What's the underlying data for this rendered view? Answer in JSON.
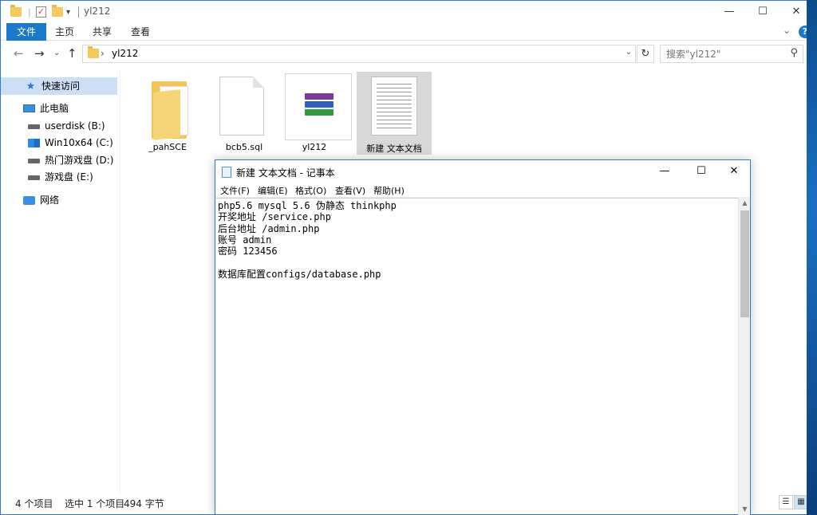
{
  "explorer": {
    "title": "yl212",
    "window_controls": {
      "minimize": "—",
      "maximize": "☐",
      "close": "✕"
    },
    "ribbon_tabs": [
      "文件",
      "主页",
      "共享",
      "查看"
    ],
    "ribbon_help": "?",
    "address_path": "yl212",
    "search_placeholder": "搜索\"yl212\"",
    "sidebar": [
      {
        "label": "快速访问",
        "icon": "star-icon"
      },
      {
        "label": "此电脑",
        "icon": "computer-icon"
      },
      {
        "label": "userdisk (B:)",
        "icon": "drive-icon"
      },
      {
        "label": "Win10x64 (C:)",
        "icon": "windows-drive-icon"
      },
      {
        "label": "热门游戏盘 (D:)",
        "icon": "drive-icon"
      },
      {
        "label": "游戏盘 (E:)",
        "icon": "drive-icon"
      },
      {
        "label": "网络",
        "icon": "network-icon"
      }
    ],
    "files": [
      {
        "name": "_pahSCE",
        "type": "folder"
      },
      {
        "name": "bcb5.sql",
        "type": "file"
      },
      {
        "name": "yl212",
        "type": "rar"
      },
      {
        "name": "新建 文本文档",
        "type": "text",
        "selected": true
      }
    ],
    "status": {
      "item_count": "4 个项目",
      "selection": "选中 1 个项目",
      "size": "494 字节"
    }
  },
  "notepad": {
    "title": "新建 文本文档 - 记事本",
    "menu": [
      "文件(F)",
      "编辑(E)",
      "格式(O)",
      "查看(V)",
      "帮助(H)"
    ],
    "content": "php5.6 mysql 5.6 伪静态 thinkphp\n开奖地址 /service.php\n后台地址 /admin.php\n账号 admin\n密码 123456\n\n数据库配置configs/database.php"
  },
  "colors": {
    "accent": "#1979ca",
    "selection": "#ccdff5",
    "folder": "#f2c558"
  }
}
